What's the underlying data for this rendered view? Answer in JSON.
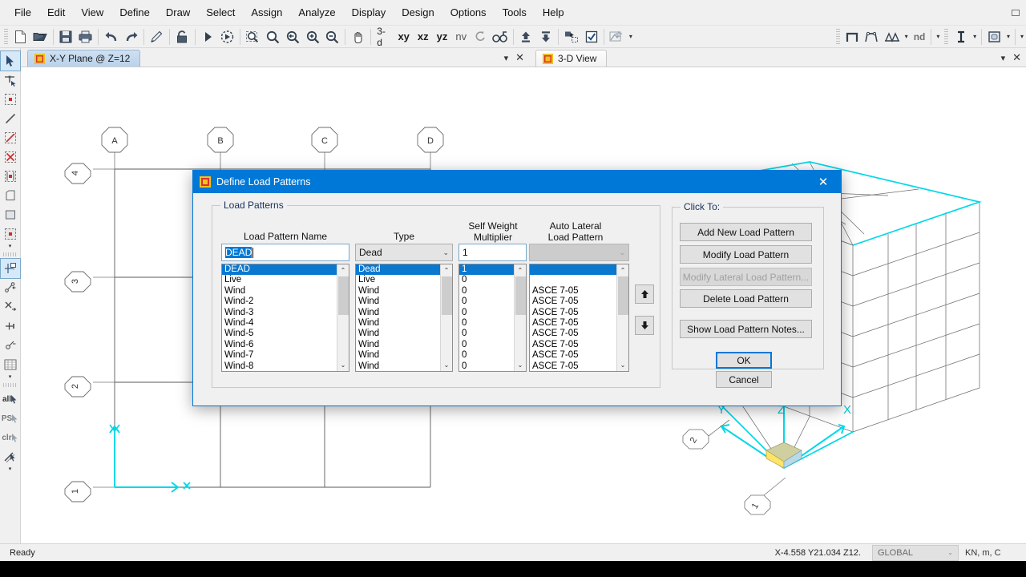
{
  "app": {
    "menu": [
      "File",
      "Edit",
      "View",
      "Define",
      "Draw",
      "Select",
      "Assign",
      "Analyze",
      "Display",
      "Design",
      "Options",
      "Tools",
      "Help"
    ],
    "view_labels": [
      "3-d",
      "xy",
      "xz",
      "yz",
      "nv"
    ],
    "nd_label": "nd"
  },
  "panes": {
    "left_tab": "X-Y Plane @ Z=12",
    "right_tab": "3-D View"
  },
  "grids": {
    "horizontal": [
      "A",
      "B",
      "C",
      "D"
    ],
    "vertical": [
      "4",
      "3",
      "2",
      "1"
    ],
    "axis_x": "X",
    "axis_y": "Y",
    "axis_z": "Z",
    "bubbles_3d": [
      "2",
      "1"
    ]
  },
  "dialog": {
    "title": "Define Load Patterns",
    "close_icon": "close-icon",
    "group_load_patterns": "Load Patterns",
    "group_click_to": "Click To:",
    "headers": {
      "name": "Load Pattern Name",
      "type": "Type",
      "self_weight": "Self Weight",
      "self_weight2": "Multiplier",
      "auto_lateral": "Auto Lateral",
      "auto_lateral2": "Load Pattern"
    },
    "inputs": {
      "name_value": "DEAD",
      "type_value": "Dead",
      "multiplier_value": "1",
      "auto_lateral_value": ""
    },
    "rows": [
      {
        "name": "DEAD",
        "type": "Dead",
        "mult": "1",
        "auto": "",
        "selected": true
      },
      {
        "name": "Live",
        "type": "Live",
        "mult": "0",
        "auto": "",
        "selected": false
      },
      {
        "name": "Wind",
        "type": "Wind",
        "mult": "0",
        "auto": "ASCE 7-05",
        "selected": false
      },
      {
        "name": "Wind-2",
        "type": "Wind",
        "mult": "0",
        "auto": "ASCE 7-05",
        "selected": false
      },
      {
        "name": "Wind-3",
        "type": "Wind",
        "mult": "0",
        "auto": "ASCE 7-05",
        "selected": false
      },
      {
        "name": "Wind-4",
        "type": "Wind",
        "mult": "0",
        "auto": "ASCE 7-05",
        "selected": false
      },
      {
        "name": "Wind-5",
        "type": "Wind",
        "mult": "0",
        "auto": "ASCE 7-05",
        "selected": false
      },
      {
        "name": "Wind-6",
        "type": "Wind",
        "mult": "0",
        "auto": "ASCE 7-05",
        "selected": false
      },
      {
        "name": "Wind-7",
        "type": "Wind",
        "mult": "0",
        "auto": "ASCE 7-05",
        "selected": false
      },
      {
        "name": "Wind-8",
        "type": "Wind",
        "mult": "0",
        "auto": "ASCE 7-05",
        "selected": false
      }
    ],
    "buttons": {
      "add": "Add New Load Pattern",
      "modify": "Modify Load Pattern",
      "modify_lateral": "Modify Lateral Load Pattern...",
      "delete": "Delete Load Pattern",
      "notes": "Show Load Pattern Notes...",
      "ok": "OK",
      "cancel": "Cancel",
      "move_up_icon": "arrow-up-icon",
      "move_down_icon": "arrow-down-icon"
    }
  },
  "statusbar": {
    "message": "Ready",
    "coordinates": "X-4.558  Y21.034  Z12.",
    "coord_system": "GLOBAL",
    "units": "KN, m, C"
  },
  "colors": {
    "accent": "#0078d7",
    "selection": "#0b78d0",
    "axis_cyan": "#00e5f0",
    "dialog_bg": "#f0f0f0"
  }
}
